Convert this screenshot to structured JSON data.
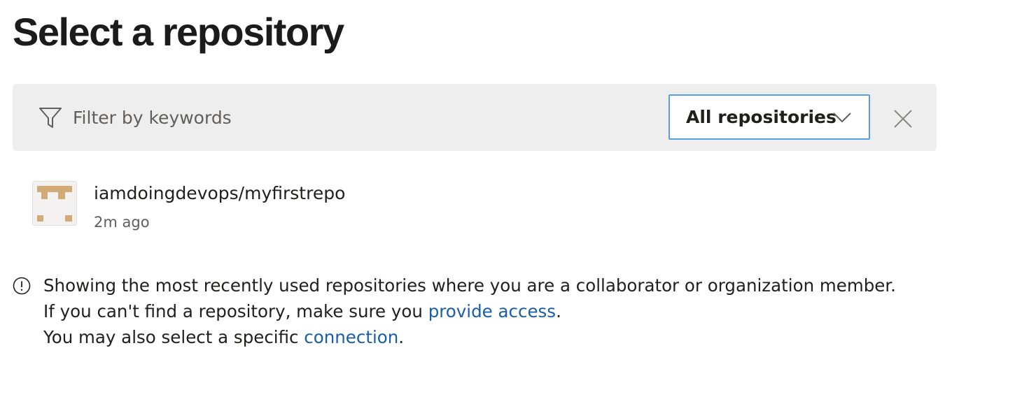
{
  "page": {
    "title": "Select a repository"
  },
  "filter": {
    "placeholder": "Filter by keywords",
    "value": "",
    "dropdown_label": "All repositories"
  },
  "repositories": [
    {
      "name": "iamdoingdevops/myfirstrepo",
      "time": "2m ago",
      "avatar_color": "#d2aa78"
    }
  ],
  "info": {
    "line1": "Showing the most recently used repositories where you are a collaborator or organization member.",
    "line2_prefix": "If you can't find a repository, make sure you ",
    "line2_link": "provide access",
    "line2_suffix": ".",
    "line3_prefix": "You may also select a specific ",
    "line3_link": "connection",
    "line3_suffix": "."
  },
  "colors": {
    "link": "#1a5ea8",
    "dropdown_border": "#5a9ee0",
    "filter_background": "#eeeeee"
  },
  "icons": {
    "filter": "filter-icon",
    "dropdown": "chevron-down-icon",
    "clear": "close-icon",
    "info": "info-icon",
    "avatar": "identicon"
  }
}
